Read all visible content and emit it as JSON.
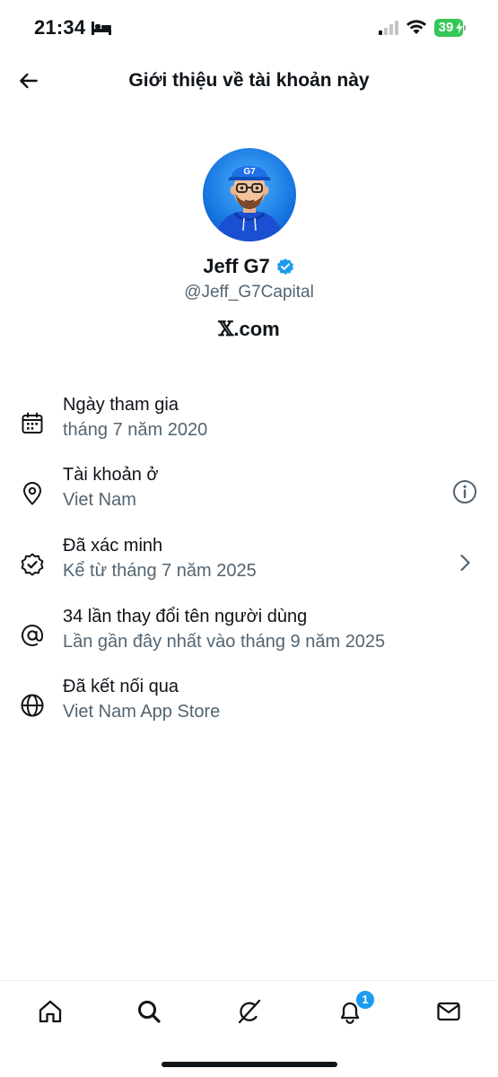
{
  "status_bar": {
    "time": "21:34",
    "battery": "39"
  },
  "header": {
    "title": "Giới thiệu về tài khoản này",
    "back_icon": "arrow-left-icon"
  },
  "profile": {
    "display_name": "Jeff G7",
    "handle": "@Jeff_G7Capital",
    "site_prefix": "𝕏",
    "site_suffix": ".com",
    "avatar_cap_text": "G7",
    "verified_color": "#1d9bf0"
  },
  "info_items": [
    {
      "icon": "calendar-icon",
      "title": "Ngày tham gia",
      "subtitle": "tháng 7 năm 2020"
    },
    {
      "icon": "location-pin-icon",
      "title": "Tài khoản ở",
      "subtitle": "Viet Nam",
      "trailing": "info-circle-icon"
    },
    {
      "icon": "verified-badge-outline-icon",
      "title": "Đã xác minh",
      "subtitle": "Kể từ tháng 7 năm 2025",
      "trailing": "chevron-right-icon"
    },
    {
      "icon": "at-sign-icon",
      "title": "34 lần thay đổi tên người dùng",
      "subtitle": "Lần gần đây nhất vào tháng 9 năm 2025"
    },
    {
      "icon": "globe-icon",
      "title": "Đã kết nối qua",
      "subtitle": "Viet Nam App Store"
    }
  ],
  "tab_bar": {
    "tabs": [
      "home-icon",
      "search-icon",
      "grok-icon",
      "notifications-icon",
      "messages-icon"
    ],
    "notification_badge": "1"
  },
  "colors": {
    "text": "#0f1419",
    "secondary": "#536471",
    "accent": "#1d9bf0",
    "battery": "#34c759"
  }
}
